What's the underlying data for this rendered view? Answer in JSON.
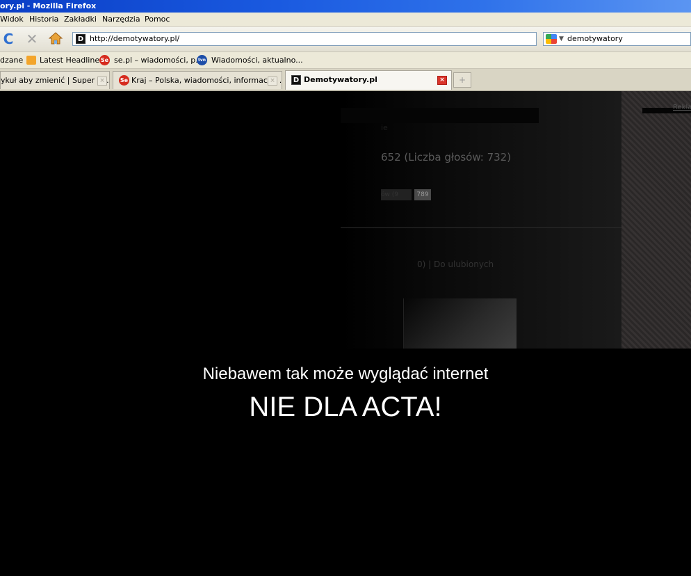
{
  "window": {
    "title": "ory.pl - Mozilla Firefox"
  },
  "menu": {
    "items": [
      "Widok",
      "Historia",
      "Zakładki",
      "Narzędzia",
      "Pomoc"
    ]
  },
  "navbar": {
    "url": "http://demotywatory.pl/",
    "search_value": "demotywatory",
    "icons": {
      "reload": "reload-icon",
      "stop": "stop-icon",
      "home": "home-icon",
      "rss": "rss-icon",
      "star": "star-icon"
    }
  },
  "bookmarks": {
    "items": [
      {
        "label": "dzane",
        "icon": ""
      },
      {
        "label": "Latest Headlines",
        "icon": "rss-icon"
      },
      {
        "label": "se.pl – wiadomości, p...",
        "icon": "se-icon"
      },
      {
        "label": "Wiadomości, aktualno...",
        "icon": "tvn-icon"
      }
    ]
  },
  "tabs": [
    {
      "label": "ykuł aby zmienić | Super Ex...",
      "active": false
    },
    {
      "label": "Kraj – Polska, wiadomości, informacje, ...",
      "active": false
    },
    {
      "label": "Demotywatory.pl",
      "active": true
    }
  ],
  "page": {
    "ghost": {
      "reklama": "Reklam",
      "text1": "ie",
      "votes": "652 (Liczba głosów: 732)",
      "btn1": "ów (9",
      "btn2": "789",
      "fav": "0) | Do ulubionych"
    },
    "message_line1": "Niebawem tak może wyglądać internet",
    "message_line2": "NIE DLA ACTA!"
  },
  "colors": {
    "title_bar": "#1a5ae0",
    "chrome": "#ece9d8",
    "page_bg": "#000000",
    "message_text": "#ffffff"
  }
}
